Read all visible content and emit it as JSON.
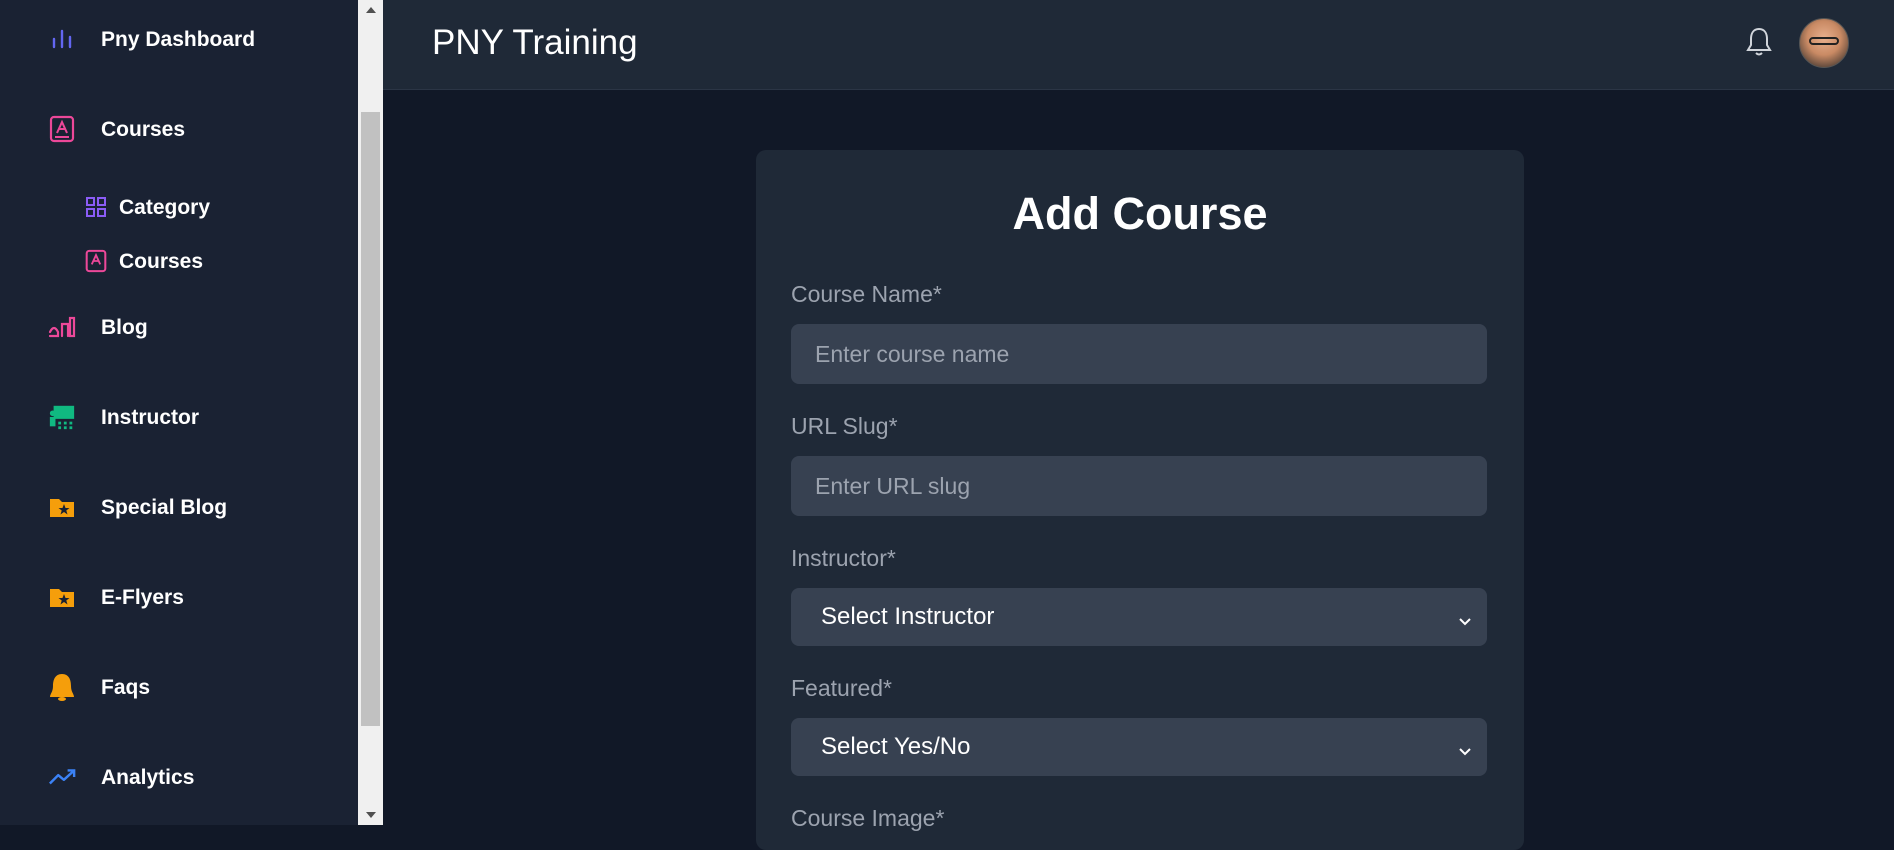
{
  "sidebar": {
    "items": [
      {
        "label": "Pny Dashboard",
        "icon": "bar-chart-icon"
      },
      {
        "label": "Courses",
        "icon": "book-icon"
      },
      {
        "label": "Category",
        "icon": "grid-icon"
      },
      {
        "label": "Courses",
        "icon": "book-icon"
      },
      {
        "label": "Blog",
        "icon": "pen-icon"
      },
      {
        "label": "Instructor",
        "icon": "teacher-icon"
      },
      {
        "label": "Special Blog",
        "icon": "folder-star-icon"
      },
      {
        "label": "E-Flyers",
        "icon": "folder-star-icon"
      },
      {
        "label": "Faqs",
        "icon": "bell-shape-icon"
      },
      {
        "label": "Analytics",
        "icon": "trending-up-icon"
      }
    ]
  },
  "header": {
    "title": "PNY Training"
  },
  "form": {
    "title": "Add Course",
    "course_name": {
      "label": "Course Name*",
      "placeholder": "Enter course name"
    },
    "url_slug": {
      "label": "URL Slug*",
      "placeholder": "Enter URL slug"
    },
    "instructor": {
      "label": "Instructor*",
      "value": "Select Instructor"
    },
    "featured": {
      "label": "Featured*",
      "value": "Select Yes/No"
    },
    "course_image": {
      "label": "Course Image*"
    }
  },
  "colors": {
    "sidebar_bg": "#1a2233",
    "page_bg": "#111827",
    "card_bg": "#1f2937",
    "input_bg": "#374151",
    "accent_pink": "#ec4899",
    "accent_purple": "#8b5cf6",
    "accent_green": "#10b981",
    "accent_amber": "#f59e0b",
    "accent_blue": "#3b82f6"
  }
}
